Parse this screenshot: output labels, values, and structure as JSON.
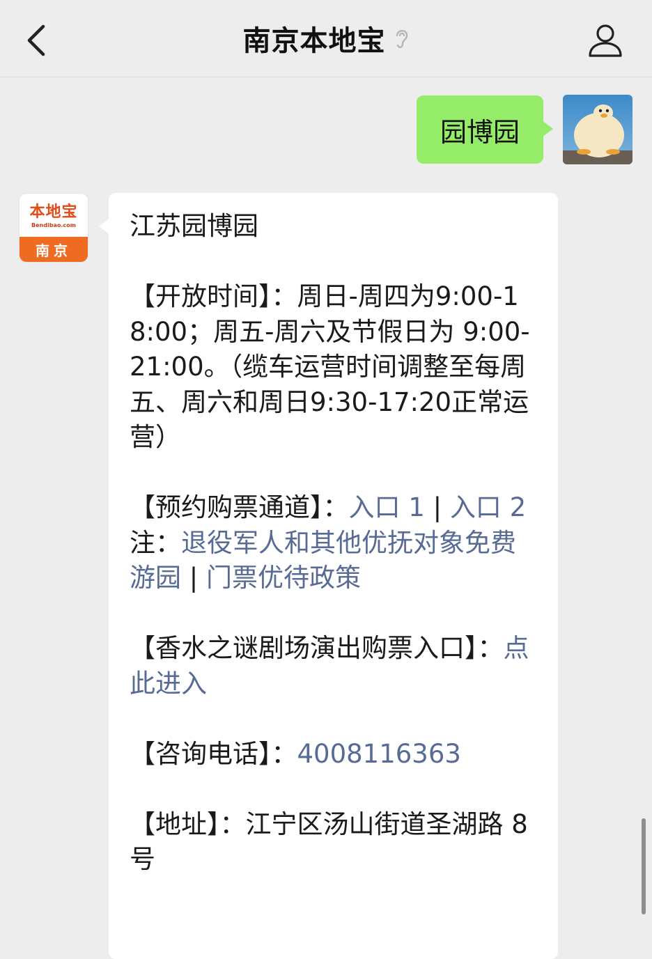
{
  "header": {
    "title": "南京本地宝",
    "back_icon": "chevron-left-icon",
    "ear_icon": "ear-icon",
    "profile_icon": "person-icon"
  },
  "user_message": {
    "text": "园博园"
  },
  "bot_avatar": {
    "logo_main": "本地宝",
    "logo_sub": "Bendibao.com",
    "logo_city": "南京"
  },
  "bot_message": {
    "title": "江苏园博园",
    "hours_label": "【开放时间】：",
    "hours_text": "周日-周四为9:00-18:00；周五-周六及节假日为 9:00-21:00。（缆车运营时间调整至每周五、周六和周日9:30-17:20正常运营）",
    "booking_label": "【预约购票通道】：",
    "booking_link1": "入口 1",
    "booking_sep": " | ",
    "booking_link2": "入口 2",
    "note_label": "注：",
    "note_link1": "退役军人和其他优抚对象免费游园",
    "note_sep": " | ",
    "note_link2": "门票优待政策",
    "show_label": "【香水之谜剧场演出购票入口】：",
    "show_link": "点此进入",
    "phone_label": "【咨询电话】：",
    "phone_link": "4008116363",
    "address_label": "【地址】：",
    "address_text": "江宁区汤山街道圣湖路 8 号"
  },
  "colors": {
    "background": "#ededed",
    "user_bubble": "#95ec69",
    "bot_bubble": "#ffffff",
    "link": "#576b95",
    "logo_orange": "#f06b22"
  }
}
